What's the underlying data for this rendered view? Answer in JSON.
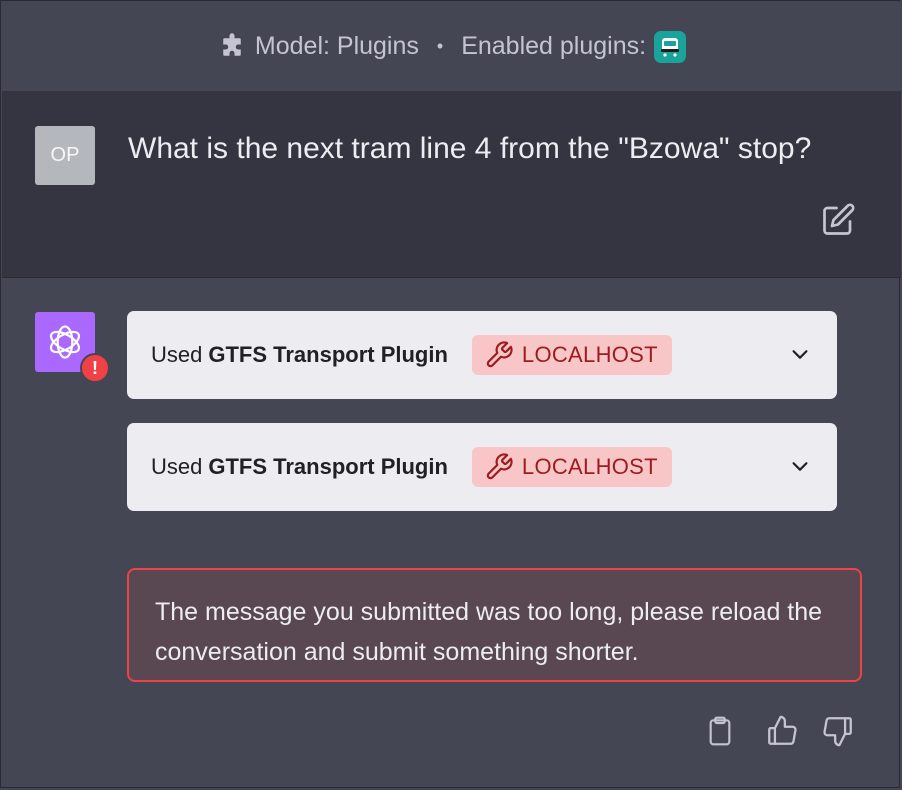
{
  "header": {
    "model_label": "Model: Plugins",
    "separator": "•",
    "enabled_label": "Enabled plugins:",
    "plugin_icon": "plugin-logo-icon",
    "plugin_color": "#1aa39a"
  },
  "user": {
    "avatar_initials": "OP",
    "message": "What is the next tram line 4 from the \"Bzowa\" stop?"
  },
  "assistant": {
    "avatar_color": "#ab68ff",
    "error_badge": "!",
    "plugin_calls": [
      {
        "used": "Used",
        "name": "GTFS Transport Plugin",
        "tag": "LOCALHOST"
      },
      {
        "used": "Used",
        "name": "GTFS Transport Plugin",
        "tag": "LOCALHOST"
      }
    ],
    "error_message": "The message you submitted was too long, please reload the conversation and submit something shorter."
  },
  "colors": {
    "background": "#444654",
    "user_bg": "#343541",
    "error_border": "#ef4146",
    "tag_bg": "#f9c6c7",
    "tag_text": "#9d1c1f"
  }
}
